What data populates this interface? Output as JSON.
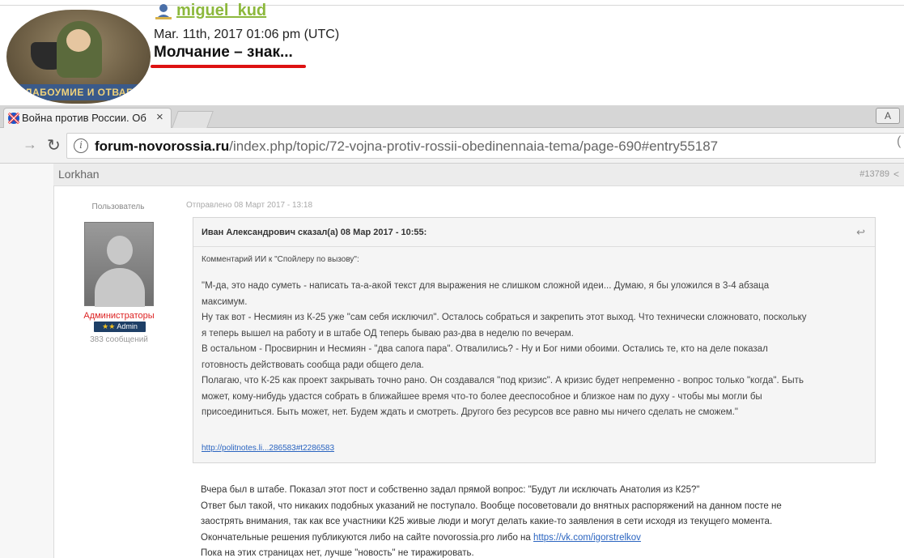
{
  "lj_post": {
    "username": "miguel_kud",
    "date": "Mar. 11th, 2017 01:06 pm (UTC)",
    "title": "Молчание – знак...",
    "userpic_caption": "СЛАБОУМИЕ И ОТВАГА"
  },
  "browser": {
    "tab_title": "Война против России. Об",
    "tab_close": "×",
    "profile_button": "A",
    "url_domain": "forum-novorossia.ru",
    "url_path": "/index.php/topic/72-vojna-protiv-rossii-obedinennaia-tema/page-690#entry55187"
  },
  "forum_post": {
    "author": "Lorkhan",
    "post_number": "#13789",
    "role_label": "Пользователь",
    "group": "Администраторы",
    "badge": "Admin",
    "post_count": "383 сообщений",
    "sent_date": "Отправлено 08 Март 2017 - 13:18"
  },
  "quote": {
    "citation": "Иван Александрович сказал(а) 08 Мар 2017 - 10:55:",
    "intro": "Комментарий ИИ к \"Спойлеру по вызову\":",
    "lines": [
      "\"М-да, это надо суметь - написать та-а-акой текст для выражения не слишком сложной идеи... Думаю, я бы уложился в 3-4 абзаца",
      "максимум.",
      "Ну так вот - Несмиян из К-25 уже \"сам себя исключил\". Осталось собраться и закрепить этот выход. Что технически сложновато, поскольку",
      "я теперь вышел на работу и в штабе ОД теперь бываю раз-два в неделю по вечерам.",
      "В остальном - Просвирнин и Несмиян - \"два сапога пара\". Отвалились? - Ну и Бог ними обоими. Остались те, кто на деле показал",
      "готовность действовать сообща ради общего дела.",
      "Полагаю, что К-25 как проект закрывать точно рано. Он создавался \"под кризис\". А кризис будет непременно - вопрос только \"когда\". Быть",
      "может, кому-нибудь удастся собрать в ближайшее время что-то более дееспособное и близкое нам по духу - чтобы мы могли бы",
      "присоединиться. Быть может, нет. Будем ждать и смотреть. Другого без ресурсов все равно мы ничего сделать не сможем.\""
    ],
    "link": "http://politnotes.li...286583#t2286583"
  },
  "reply": {
    "line1": "Вчера был в штабе. Показал этот пост и собственно задал прямой вопрос: \"Будут ли исключать Анатолия из К25?\"",
    "line2": "Ответ был такой, что никаких подобных указаний не поступало. Вообще посоветовали до внятных распоряжений на данном посте не",
    "line3": "заострять внимания, так как все участники К25 живые люди и могут делать какие-то заявления в сети исходя из текущего момента.",
    "line4_prefix": "Окончательные решения публикуются либо на сайте novorossia.pro либо на ",
    "line4_link": "https://vk.com/igorstrelkov",
    "line5": "Пока на этих страницах нет, лучше \"новость\" не тиражировать."
  },
  "colors": {
    "username": "#8cb83c",
    "title_underline": "#dd1111",
    "admin_group": "#dd2222",
    "badge_bg": "#1e3f66",
    "link": "#2a64c0"
  },
  "icons": [
    "user-icon",
    "tab-favicon-flag",
    "close-icon",
    "forward-icon",
    "reload-icon",
    "info-icon",
    "share-icon",
    "quote-arrow-icon"
  ]
}
